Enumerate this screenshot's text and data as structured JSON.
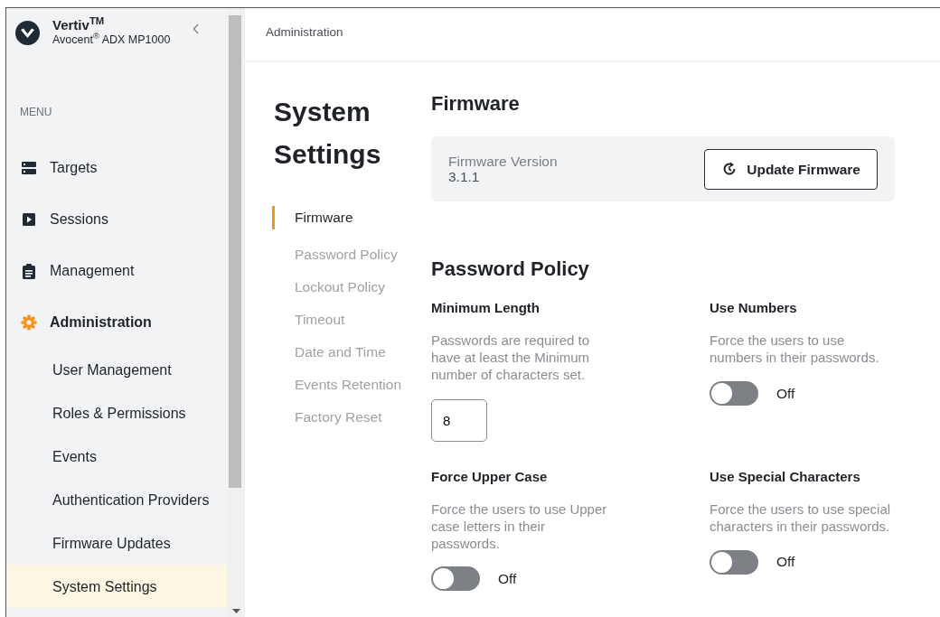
{
  "breadcrumb": "Administration",
  "sidebar": {
    "brand": "Vertiv$^{TM}$",
    "product": "Avocent$^{®}$ ADX MP1000",
    "section_label": "MENU",
    "items": [
      {
        "label": "Targets",
        "selected": false
      },
      {
        "label": "Sessions",
        "selected": false
      },
      {
        "label": "Management",
        "selected": false
      },
      {
        "label": "Administration",
        "selected": true,
        "children": [
          {
            "label": "User Management",
            "selected": false
          },
          {
            "label": "Roles & Permissions",
            "selected": false
          },
          {
            "label": "Events",
            "selected": false
          },
          {
            "label": "Authentication Providers",
            "selected": false
          },
          {
            "label": "Firmware Updates",
            "selected": false
          },
          {
            "label": "System Settings",
            "selected": true
          }
        ]
      }
    ]
  },
  "page_title": "System Settings",
  "sections": [
    {
      "label": "Firmware",
      "selected": true
    },
    {
      "label": "Password Policy",
      "selected": false
    },
    {
      "label": "Lockout Policy",
      "selected": false
    },
    {
      "label": "Timeout",
      "selected": false
    },
    {
      "label": "Date and Time",
      "selected": false
    },
    {
      "label": "Events Retention",
      "selected": false
    },
    {
      "label": "Factory Reset",
      "selected": false
    }
  ],
  "firmware": {
    "heading": "Firmware",
    "version_label": "Firmware Version",
    "version": "3.1.1",
    "button": "Update Firmware"
  },
  "password_policy": {
    "heading": "Password Policy",
    "settings": [
      {
        "kind": "number",
        "title": "Minimum Length",
        "description": "Passwords are required to have at least the Minimum number of characters set.",
        "value": "8"
      },
      {
        "kind": "toggle",
        "title": "Use Numbers",
        "description": "Force the users to use numbers in their passwords.",
        "on": false,
        "state_label": "Off"
      },
      {
        "kind": "toggle",
        "title": "Force Upper Case",
        "description": "Force the users to use Upper case letters in their passwords.",
        "on": false,
        "state_label": "Off"
      },
      {
        "kind": "toggle",
        "title": "Use Special Characters",
        "description": "Force the users to use special characters in their passwords.",
        "on": false,
        "state_label": "Off"
      }
    ]
  }
}
